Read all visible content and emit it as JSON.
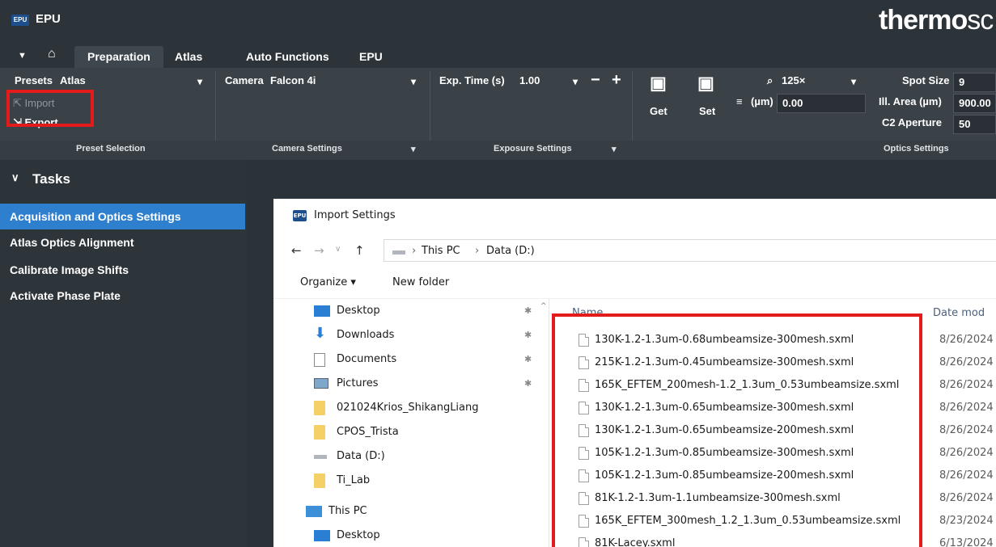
{
  "app": {
    "badge": "EPU",
    "title": "EPU",
    "brand_bold": "thermo",
    "brand_rest": "sc"
  },
  "tabs": [
    {
      "label": "Preparation",
      "active": true
    },
    {
      "label": "Atlas",
      "active": false
    },
    {
      "label": "Auto Functions",
      "active": false
    },
    {
      "label": "EPU",
      "active": false
    }
  ],
  "ribbon": {
    "presets_label": "Presets",
    "presets_value": "Atlas",
    "import_label": "Import",
    "export_label": "Export",
    "camera_label": "Camera",
    "camera_value": "Falcon 4i",
    "exp_time_label": "Exp. Time (s)",
    "exp_time_value": "1.00",
    "minus_label": "−",
    "plus_label": "+",
    "get_label": "Get",
    "set_label": "Set",
    "mag_value": "125×",
    "defocus_label": "(µm)",
    "defocus_value": "0.00",
    "spot_size_label": "Spot Size",
    "spot_size_value": "9",
    "ill_area_label": "Ill. Area (µm)",
    "ill_area_value": "900.00",
    "c2_label": "C2 Aperture",
    "c2_value": "50",
    "groups": {
      "preset_selection": "Preset Selection",
      "camera_settings": "Camera Settings",
      "exposure_settings": "Exposure Settings",
      "optics_settings": "Optics Settings"
    }
  },
  "tasks": {
    "header": "Tasks",
    "items": [
      {
        "label": "Acquisition and Optics Settings",
        "active": true
      },
      {
        "label": "Atlas Optics Alignment",
        "active": false
      },
      {
        "label": "Calibrate Image Shifts",
        "active": false
      },
      {
        "label": "Activate Phase Plate",
        "active": false
      }
    ]
  },
  "dialog": {
    "icon": "EPU",
    "title": "Import Settings",
    "breadcrumb": [
      "This PC",
      "Data (D:)"
    ],
    "organize_label": "Organize ▾",
    "new_folder_label": "New folder",
    "nav_items": [
      {
        "label": "Desktop",
        "icon": "desktop-icon",
        "pinned": true
      },
      {
        "label": "Downloads",
        "icon": "downloads-icon",
        "pinned": true
      },
      {
        "label": "Documents",
        "icon": "documents-icon",
        "pinned": true
      },
      {
        "label": "Pictures",
        "icon": "pictures-icon",
        "pinned": true
      },
      {
        "label": "021024Krios_ShikangLiang",
        "icon": "folder-icon",
        "pinned": false
      },
      {
        "label": "CPOS_Trista",
        "icon": "folder-icon",
        "pinned": false
      },
      {
        "label": "Data (D:)",
        "icon": "drive-icon",
        "pinned": false
      },
      {
        "label": "Ti_Lab",
        "icon": "folder-icon",
        "pinned": false
      },
      {
        "label": "This PC",
        "icon": "this-pc-icon",
        "pinned": false
      },
      {
        "label": "Desktop",
        "icon": "desktop-icon",
        "pinned": false
      }
    ],
    "columns": {
      "name": "Name",
      "date": "Date mod"
    },
    "files": [
      {
        "name": "130K-1.2-1.3um-0.68umbeamsize-300mesh.sxml",
        "date": "8/26/2024"
      },
      {
        "name": "215K-1.2-1.3um-0.45umbeamsize-300mesh.sxml",
        "date": "8/26/2024"
      },
      {
        "name": "165K_EFTEM_200mesh-1.2_1.3um_0.53umbeamsize.sxml",
        "date": "8/26/2024"
      },
      {
        "name": "130K-1.2-1.3um-0.65umbeamsize-300mesh.sxml",
        "date": "8/26/2024"
      },
      {
        "name": "130K-1.2-1.3um-0.65umbeamsize-200mesh.sxml",
        "date": "8/26/2024"
      },
      {
        "name": "105K-1.2-1.3um-0.85umbeamsize-300mesh.sxml",
        "date": "8/26/2024"
      },
      {
        "name": "105K-1.2-1.3um-0.85umbeamsize-200mesh.sxml",
        "date": "8/26/2024"
      },
      {
        "name": "81K-1.2-1.3um-1.1umbeamsize-300mesh.sxml",
        "date": "8/26/2024"
      },
      {
        "name": "165K_EFTEM_300mesh_1.2_1.3um_0.53umbeamsize.sxml",
        "date": "8/23/2024"
      },
      {
        "name": "81K-Lacey.sxml",
        "date": "6/13/2024"
      }
    ]
  },
  "colors": {
    "highlight_red": "#e31b1b",
    "active_task_blue": "#2f7fcf"
  }
}
